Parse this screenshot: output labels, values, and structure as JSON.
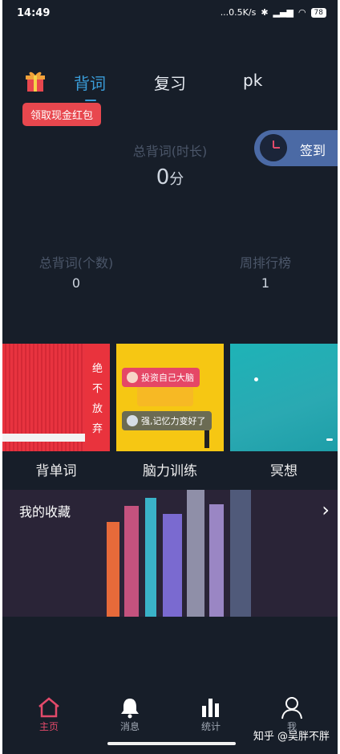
{
  "status_bar": {
    "time": "14:49",
    "network_speed": "...0.5K/s",
    "battery": "78"
  },
  "tabs": [
    {
      "label": "背词",
      "active": true
    },
    {
      "label": "复习",
      "active": false
    },
    {
      "label": "pk",
      "active": false
    }
  ],
  "red_packet": {
    "label": "领取现金红包"
  },
  "checkin": {
    "label": "签到",
    "icon": "clock-icon"
  },
  "stats": {
    "total_time_label": "总背词(时长)",
    "total_time_value": "0",
    "total_time_unit": "分",
    "total_count_label": "总背词(个数)",
    "total_count_value": "0",
    "weekly_rank_label": "周排行榜",
    "weekly_rank_value": "1"
  },
  "tiles": [
    {
      "label": "背单词",
      "banner_chars": [
        "绝",
        "不",
        "放",
        "弃"
      ]
    },
    {
      "label": "脑力训练",
      "bubble_1": "投资自己大脑",
      "bubble_2": "强,记忆力变好了"
    },
    {
      "label": "冥想"
    }
  ],
  "favorites": {
    "title": "我的收藏"
  },
  "bottom_nav": [
    {
      "label": "主页",
      "icon": "home-icon",
      "active": true
    },
    {
      "label": "消息",
      "icon": "bell-icon",
      "active": false
    },
    {
      "label": "统计",
      "icon": "bar-chart-icon",
      "active": false
    },
    {
      "label": "我",
      "icon": "user-icon",
      "active": false
    }
  ],
  "watermark": "知乎 @吴胖不胖",
  "colors": {
    "background": "#171e29",
    "tab_active": "#3a9cd8",
    "nav_active": "#e24a6a",
    "red_packet": "#e8474e",
    "checkin": "#4b6aa5"
  }
}
